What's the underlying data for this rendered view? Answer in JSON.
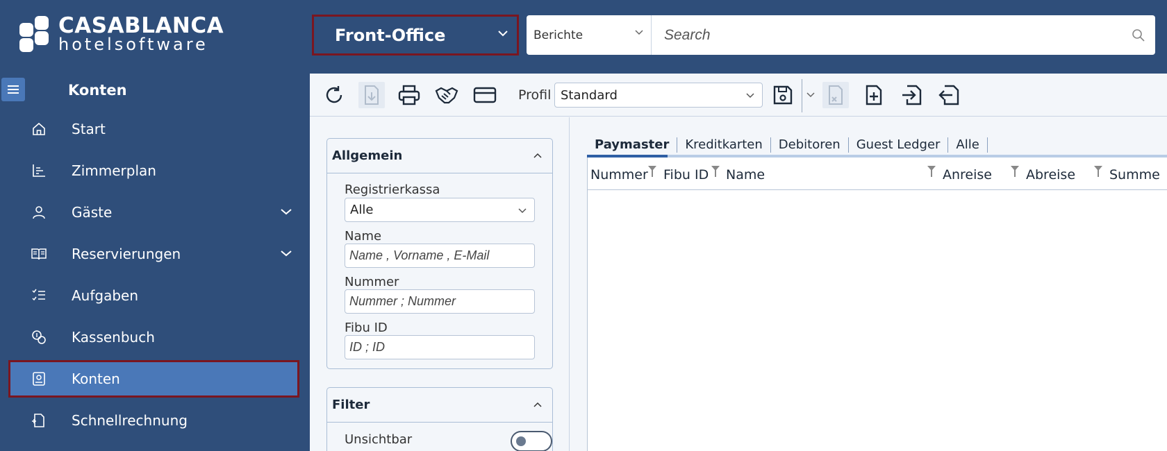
{
  "header": {
    "brand_line1": "CASABLANCA",
    "brand_line2": "hotelsoftware",
    "module_selected": "Front-Office",
    "search_category": "Berichte",
    "search_placeholder": "Search"
  },
  "sidebar": {
    "title": "Konten",
    "items": [
      {
        "label": "Start",
        "icon": "home-icon",
        "expandable": false
      },
      {
        "label": "Zimmerplan",
        "icon": "chart-icon",
        "expandable": false
      },
      {
        "label": "Gäste",
        "icon": "person-icon",
        "expandable": true
      },
      {
        "label": "Reservierungen",
        "icon": "book-icon",
        "expandable": true
      },
      {
        "label": "Aufgaben",
        "icon": "tasks-icon",
        "expandable": false
      },
      {
        "label": "Kassenbuch",
        "icon": "coins-icon",
        "expandable": false
      },
      {
        "label": "Konten",
        "icon": "account-icon",
        "expandable": false,
        "active": true
      },
      {
        "label": "Schnellrechnung",
        "icon": "quick-invoice-icon",
        "expandable": false
      }
    ]
  },
  "toolbar": {
    "profile_label": "Profil",
    "profile_value": "Standard"
  },
  "filters": {
    "general": {
      "title": "Allgemein",
      "register_label": "Registrierkassa",
      "register_value": "Alle",
      "name_label": "Name",
      "name_placeholder": "Name , Vorname , E-Mail",
      "number_label": "Nummer",
      "number_placeholder": "Nummer ; Nummer",
      "fibu_label": "Fibu ID",
      "fibu_placeholder": "ID ; ID"
    },
    "filter": {
      "title": "Filter",
      "invisible_label": "Unsichtbar",
      "invisible_on": false
    }
  },
  "content": {
    "tabs": [
      "Paymaster",
      "Kreditkarten",
      "Debitoren",
      "Guest Ledger",
      "Alle"
    ],
    "active_tab": 0,
    "columns": [
      "Nummer",
      "Fibu ID",
      "Name",
      "Anreise",
      "Abreise",
      "Summe"
    ]
  },
  "colors": {
    "primary": "#2f4e7a",
    "active": "#4a78b8",
    "highlight_border": "#7a1620"
  }
}
